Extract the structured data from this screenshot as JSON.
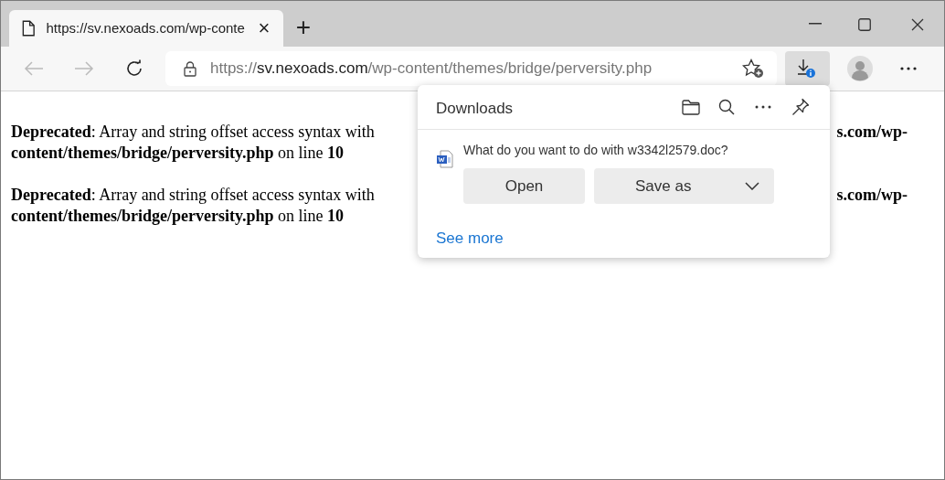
{
  "tab": {
    "title": "https://sv.nexoads.com/wp-conte",
    "close": "×",
    "new_tab": "+"
  },
  "address_bar": {
    "scheme": "https://",
    "host": "sv.nexoads.com",
    "path": "/wp-content/themes/bridge/perversity.php"
  },
  "downloads_button": {
    "selected": true
  },
  "page": {
    "messages": [
      {
        "start": "**Deprecated**: Array and string offset access syntax with",
        "end": "**s.com/wp-**",
        "line2": "**content/themes/bridge/perversity.php** on line **10**"
      },
      {
        "start": "**Deprecated**: Array and string offset access syntax with",
        "end": "**s.com/wp-**",
        "line2": "**content/themes/bridge/perversity.php** on line **10**"
      }
    ]
  },
  "downloads_panel": {
    "title": "Downloads",
    "question": "What do you want to do with w3342l2579.doc?",
    "buttons": [
      "Open",
      "Save as"
    ],
    "link": "See more"
  }
}
